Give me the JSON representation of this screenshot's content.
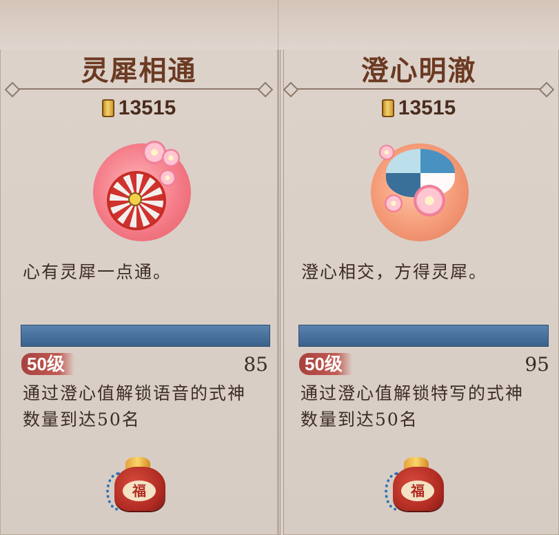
{
  "cards": [
    {
      "title": "灵犀相通",
      "price": "13515",
      "currency_icon": "coupon-icon",
      "emblem": "pink-wheel-emblem",
      "description": "心有灵犀一点通。",
      "progress": 1.0,
      "level_badge": "50级",
      "level_value": "85",
      "condition": "通过澄心值解锁语音的式神数量到达50名",
      "reward_icon": "fortune-bag-icon",
      "reward_label": "福"
    },
    {
      "title": "澄心明澈",
      "price": "13515",
      "currency_icon": "coupon-icon",
      "emblem": "pinwheel-flower-emblem",
      "description": "澄心相交，方得灵犀。",
      "progress": 1.0,
      "level_badge": "50级",
      "level_value": "95",
      "condition": "通过澄心值解锁特写的式神数量到达50名",
      "reward_icon": "fortune-bag-icon",
      "reward_label": "福"
    }
  ],
  "colors": {
    "title": "#6b3a22",
    "progress_bar": "#456f9a",
    "level_badge": "#a8413e",
    "card_bg": "#ddd3cb"
  }
}
